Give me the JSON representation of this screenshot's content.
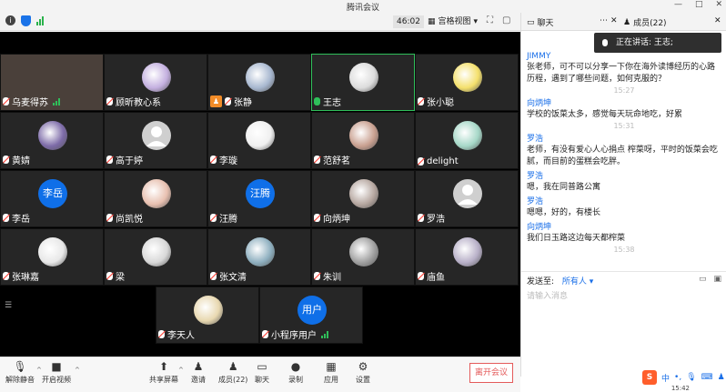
{
  "window": {
    "title": "腾讯会议",
    "min": "—",
    "max": "□",
    "close": "✕"
  },
  "toolbar": {
    "timer": "46:02",
    "view_label": "宫格视图",
    "info_icon": "i"
  },
  "tiles": [
    {
      "name": "乌麦得苏",
      "mic": "off",
      "avatar": "photo",
      "bars": true
    },
    {
      "name": "顾昕教心系",
      "mic": "off",
      "avatar": "img",
      "color": "#c4b0e0"
    },
    {
      "name": "张静",
      "mic": "off",
      "avatar": "img",
      "color": "#a8b8d0",
      "host": true
    },
    {
      "name": "王志",
      "mic": "on",
      "avatar": "img",
      "color": "#dcdcdc",
      "active": true
    },
    {
      "name": "张小聪",
      "mic": "off",
      "avatar": "img",
      "color": "#f4e06c"
    },
    {
      "name": "黄婧",
      "mic": "off",
      "avatar": "img",
      "color": "#7d6ba8"
    },
    {
      "name": "高于婷",
      "mic": "off",
      "avatar": "default",
      "color": "#cfcfcf"
    },
    {
      "name": "李璇",
      "mic": "off",
      "avatar": "img",
      "color": "#f0f0f0"
    },
    {
      "name": "范舒茗",
      "mic": "off",
      "avatar": "img",
      "color": "#c9a090"
    },
    {
      "name": "delight",
      "mic": "off",
      "avatar": "img",
      "color": "#a6d8c8"
    },
    {
      "name": "李岳",
      "mic": "off",
      "avatar": "text",
      "text": "李岳"
    },
    {
      "name": "尚凯悦",
      "mic": "off",
      "avatar": "img",
      "color": "#e8c0b0"
    },
    {
      "name": "汪腾",
      "mic": "off",
      "avatar": "text",
      "text": "汪腾"
    },
    {
      "name": "向炳坤",
      "mic": "off",
      "avatar": "img",
      "color": "#b6a7a0"
    },
    {
      "name": "罗浩",
      "mic": "off",
      "avatar": "default",
      "color": "#cfcfcf"
    },
    {
      "name": "张琳嘉",
      "mic": "off",
      "avatar": "img",
      "color": "#e8e8e8"
    },
    {
      "name": "梁",
      "mic": "off",
      "avatar": "img",
      "color": "#d8d8d8"
    },
    {
      "name": "张文清",
      "mic": "off",
      "avatar": "img",
      "color": "#8fb0c0"
    },
    {
      "name": "朱训",
      "mic": "off",
      "avatar": "img",
      "color": "#a0a0a0"
    },
    {
      "name": "庙鱼",
      "mic": "off",
      "avatar": "img",
      "color": "#b8b0c8"
    },
    {
      "name": "李天人",
      "mic": "off",
      "avatar": "img",
      "color": "#e8d8b0"
    },
    {
      "name": "小程序用户",
      "mic": "off",
      "avatar": "text",
      "text": "用户",
      "bars": true
    }
  ],
  "controls": {
    "mute": "解除静音",
    "video": "开启视频",
    "share": "共享屏幕",
    "invite": "邀请",
    "members": "成员(22)",
    "chat": "聊天",
    "record": "录制",
    "apps": "应用",
    "settings": "设置",
    "leave": "离开会议"
  },
  "panel": {
    "chat_tab": "聊天",
    "members_tab": "成员(22)",
    "speaking": "正在讲话: 王志;",
    "messages": [
      {
        "sender": "JIMMY",
        "text": "张老师，可不可以分享一下你在海外读博经历的心路历程，遇到了哪些问题，如何克服的？",
        "time": "15:27"
      },
      {
        "sender": "向炳坤",
        "text": "学校的饭菜太多，感觉每天玩命地吃，好累",
        "time": "15:31"
      },
      {
        "sender": "罗浩",
        "text": "老师，有没有爱心人心捐点 榨菜呀，平时的饭菜会吃腻，而目前的蛋糕会吃胖。",
        "time": ""
      },
      {
        "sender": "罗浩",
        "text": "嗯，我在同普路公寓",
        "time": ""
      },
      {
        "sender": "罗浩",
        "text": "嗯嗯，好的，有楼长",
        "time": ""
      },
      {
        "sender": "向炳坤",
        "text": "我们日玉路这边每天都榨菜",
        "time": "15:38"
      }
    ],
    "send_to_label": "发送至:",
    "send_to_value": "所有人",
    "input_placeholder": "请输入消息"
  },
  "ime": {
    "logo": "S",
    "lang": "中"
  },
  "clock": "15:42"
}
